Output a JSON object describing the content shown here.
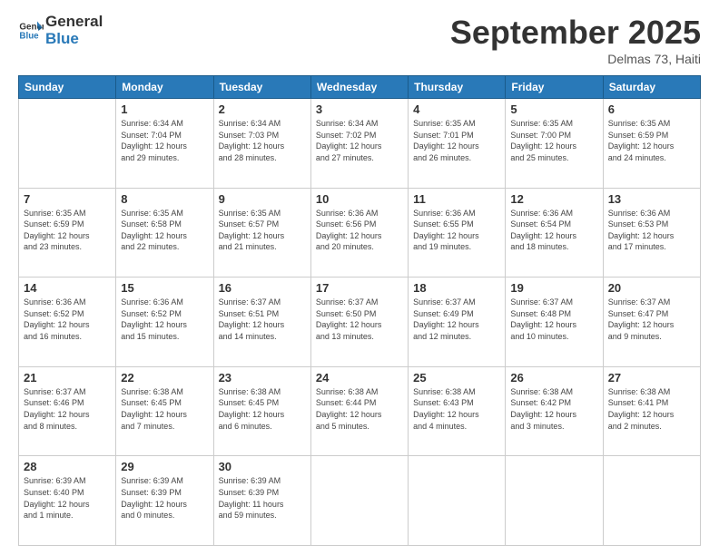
{
  "header": {
    "logo_line1": "General",
    "logo_line2": "Blue",
    "title": "September 2025",
    "location": "Delmas 73, Haiti"
  },
  "columns": [
    "Sunday",
    "Monday",
    "Tuesday",
    "Wednesday",
    "Thursday",
    "Friday",
    "Saturday"
  ],
  "weeks": [
    [
      {
        "day": "",
        "text": ""
      },
      {
        "day": "1",
        "text": "Sunrise: 6:34 AM\nSunset: 7:04 PM\nDaylight: 12 hours\nand 29 minutes."
      },
      {
        "day": "2",
        "text": "Sunrise: 6:34 AM\nSunset: 7:03 PM\nDaylight: 12 hours\nand 28 minutes."
      },
      {
        "day": "3",
        "text": "Sunrise: 6:34 AM\nSunset: 7:02 PM\nDaylight: 12 hours\nand 27 minutes."
      },
      {
        "day": "4",
        "text": "Sunrise: 6:35 AM\nSunset: 7:01 PM\nDaylight: 12 hours\nand 26 minutes."
      },
      {
        "day": "5",
        "text": "Sunrise: 6:35 AM\nSunset: 7:00 PM\nDaylight: 12 hours\nand 25 minutes."
      },
      {
        "day": "6",
        "text": "Sunrise: 6:35 AM\nSunset: 6:59 PM\nDaylight: 12 hours\nand 24 minutes."
      }
    ],
    [
      {
        "day": "7",
        "text": "Sunrise: 6:35 AM\nSunset: 6:59 PM\nDaylight: 12 hours\nand 23 minutes."
      },
      {
        "day": "8",
        "text": "Sunrise: 6:35 AM\nSunset: 6:58 PM\nDaylight: 12 hours\nand 22 minutes."
      },
      {
        "day": "9",
        "text": "Sunrise: 6:35 AM\nSunset: 6:57 PM\nDaylight: 12 hours\nand 21 minutes."
      },
      {
        "day": "10",
        "text": "Sunrise: 6:36 AM\nSunset: 6:56 PM\nDaylight: 12 hours\nand 20 minutes."
      },
      {
        "day": "11",
        "text": "Sunrise: 6:36 AM\nSunset: 6:55 PM\nDaylight: 12 hours\nand 19 minutes."
      },
      {
        "day": "12",
        "text": "Sunrise: 6:36 AM\nSunset: 6:54 PM\nDaylight: 12 hours\nand 18 minutes."
      },
      {
        "day": "13",
        "text": "Sunrise: 6:36 AM\nSunset: 6:53 PM\nDaylight: 12 hours\nand 17 minutes."
      }
    ],
    [
      {
        "day": "14",
        "text": "Sunrise: 6:36 AM\nSunset: 6:52 PM\nDaylight: 12 hours\nand 16 minutes."
      },
      {
        "day": "15",
        "text": "Sunrise: 6:36 AM\nSunset: 6:52 PM\nDaylight: 12 hours\nand 15 minutes."
      },
      {
        "day": "16",
        "text": "Sunrise: 6:37 AM\nSunset: 6:51 PM\nDaylight: 12 hours\nand 14 minutes."
      },
      {
        "day": "17",
        "text": "Sunrise: 6:37 AM\nSunset: 6:50 PM\nDaylight: 12 hours\nand 13 minutes."
      },
      {
        "day": "18",
        "text": "Sunrise: 6:37 AM\nSunset: 6:49 PM\nDaylight: 12 hours\nand 12 minutes."
      },
      {
        "day": "19",
        "text": "Sunrise: 6:37 AM\nSunset: 6:48 PM\nDaylight: 12 hours\nand 10 minutes."
      },
      {
        "day": "20",
        "text": "Sunrise: 6:37 AM\nSunset: 6:47 PM\nDaylight: 12 hours\nand 9 minutes."
      }
    ],
    [
      {
        "day": "21",
        "text": "Sunrise: 6:37 AM\nSunset: 6:46 PM\nDaylight: 12 hours\nand 8 minutes."
      },
      {
        "day": "22",
        "text": "Sunrise: 6:38 AM\nSunset: 6:45 PM\nDaylight: 12 hours\nand 7 minutes."
      },
      {
        "day": "23",
        "text": "Sunrise: 6:38 AM\nSunset: 6:45 PM\nDaylight: 12 hours\nand 6 minutes."
      },
      {
        "day": "24",
        "text": "Sunrise: 6:38 AM\nSunset: 6:44 PM\nDaylight: 12 hours\nand 5 minutes."
      },
      {
        "day": "25",
        "text": "Sunrise: 6:38 AM\nSunset: 6:43 PM\nDaylight: 12 hours\nand 4 minutes."
      },
      {
        "day": "26",
        "text": "Sunrise: 6:38 AM\nSunset: 6:42 PM\nDaylight: 12 hours\nand 3 minutes."
      },
      {
        "day": "27",
        "text": "Sunrise: 6:38 AM\nSunset: 6:41 PM\nDaylight: 12 hours\nand 2 minutes."
      }
    ],
    [
      {
        "day": "28",
        "text": "Sunrise: 6:39 AM\nSunset: 6:40 PM\nDaylight: 12 hours\nand 1 minute."
      },
      {
        "day": "29",
        "text": "Sunrise: 6:39 AM\nSunset: 6:39 PM\nDaylight: 12 hours\nand 0 minutes."
      },
      {
        "day": "30",
        "text": "Sunrise: 6:39 AM\nSunset: 6:39 PM\nDaylight: 11 hours\nand 59 minutes."
      },
      {
        "day": "",
        "text": ""
      },
      {
        "day": "",
        "text": ""
      },
      {
        "day": "",
        "text": ""
      },
      {
        "day": "",
        "text": ""
      }
    ]
  ]
}
